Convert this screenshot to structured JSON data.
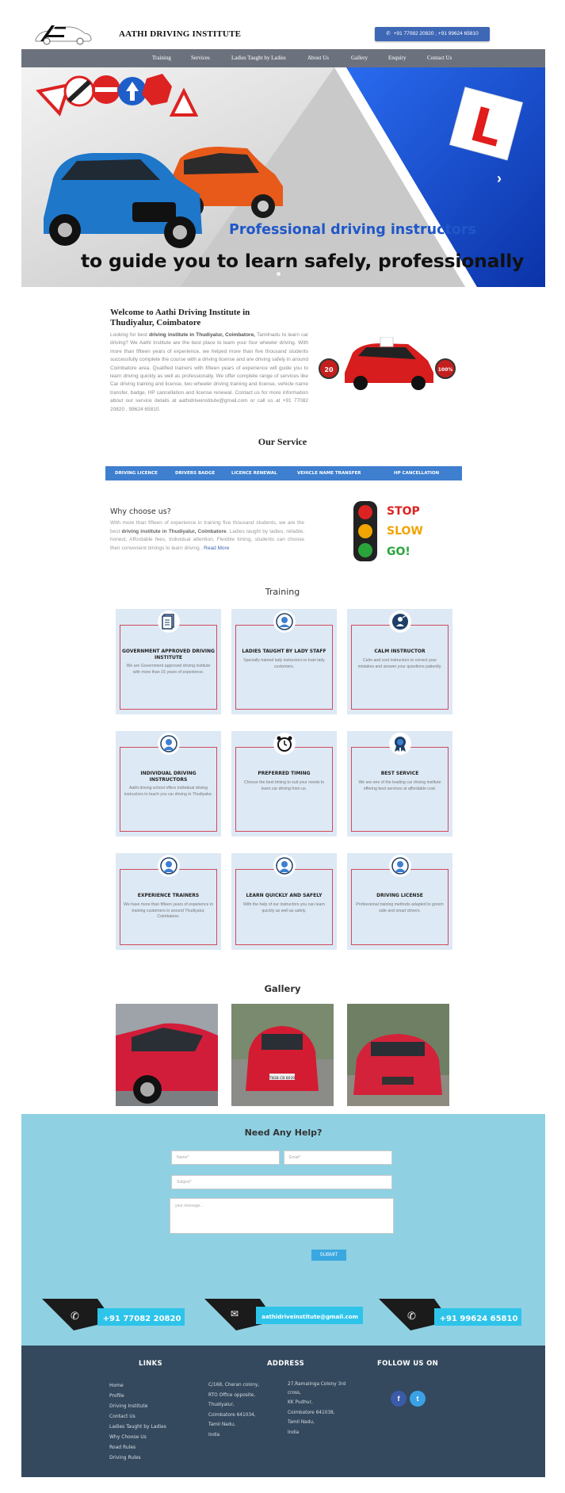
{
  "header": {
    "title": "AATHI DRIVING INSTITUTE",
    "phones": "+91 77082 20820 ,  +91 99624 65810"
  },
  "nav": [
    "Training",
    "Services",
    "Ladies Taught by Ladies",
    "About Us",
    "Gallery",
    "Enquiry",
    "Contact Us"
  ],
  "hero": {
    "headline": "Professional driving instructors",
    "subline": "to guide you to learn safely, professionally",
    "signs": [
      "GIVE WAY",
      "STOP"
    ],
    "plate": "L"
  },
  "welcome": {
    "title": "Welcome to Aathi Driving Institute in Thudiyalur, Coimbatore",
    "text_1": "Looking for best ",
    "bold_1": "driving institute in Thudiyalur, Coimbatore,",
    "text_2": " Tamilnadu to learn car driving? We Aathi Institute are the best place to learn your four wheeler driving. With more than fifteen years of experience, we helped more than five thousand students successfully complete the course with a driving license and are driving safely in around Coimbatore area. Qualified trainers with fifteen years of experience will guide you to learn driving quickly as well as professionally. We offer complete range of services like Car driving training and license, two wheeler driving training and license, vehicle name transfer, badge, HP cancellation and license renewal. Contact us for more information about our service details at aathidriveinstitute@gmail.com or call us at  +91 77082 20820 ,  99624 65810.",
    "badge_left": "20",
    "badge_right": "100%"
  },
  "services": {
    "title": "Our Service",
    "items": [
      "DRIVING LICENCE",
      "DRIVERS BADGE",
      "LICENCE RENEWAL",
      "VEHICLE NAME TRANSFER",
      "HP CANCELLATION"
    ]
  },
  "why": {
    "title": "Why choose us?",
    "text_1": "With more than fifteen of experience in training five thousand students, we are the best ",
    "bold_1": "driving institute in Thudiyalur, Coimbatore",
    "text_2": ". Ladies taught by ladies, reliable, honest, Affordable fees, Individual attention, Flexible timing, students can choose their convenient timings to learn driving . ",
    "read_more": "Read More",
    "signal_words": [
      "STOP",
      "SLOW",
      "GO!"
    ]
  },
  "training": {
    "title": "Training",
    "cards": [
      {
        "icon": "document-icon",
        "title": "GOVERNMENT APPROVED DRIVING INSTITUTE",
        "text": "We are Government approved driving institute with more than 15 years of experience."
      },
      {
        "icon": "lady-icon",
        "title": "LADIES TAUGHT BY LADY STAFF",
        "text": "Specially trained lady instructors to train lady customers."
      },
      {
        "icon": "instructor-icon",
        "title": "CALM INSTRUCTOR",
        "text": "Calm and cool instructors to correct your mistakes and answer your questions patiently."
      },
      {
        "icon": "user-icon",
        "title": "INDIVIDUAL DRIVING INSTRUCTORS",
        "text": "Aathi driving school offers individual driving instructors to teach you car driving in Thudiyalur."
      },
      {
        "icon": "alarm-clock-icon",
        "title": "PREFERRED TIMING",
        "text": "Choose the best timing to suit your needs to learn car driving from us."
      },
      {
        "icon": "award-icon",
        "title": "BEST SERVICE",
        "text": "We are one of the leading car driving institute offering best services at affordable cost."
      },
      {
        "icon": "user-icon",
        "title": "EXPERIENCE TRAINERS",
        "text": "We have more than fifteen years of experience in training customers in around Thudiyalur, Coimbatore."
      },
      {
        "icon": "user-icon",
        "title": "LEARN QUICKLY AND SAFELY",
        "text": "With the help of our instructors you can learn quickly as well as safely."
      },
      {
        "icon": "user-icon",
        "title": "DRIVING LICENSE",
        "text": "Professional training methods adapted to groom safe and smart drivers."
      }
    ]
  },
  "gallery": {
    "title": "Gallery",
    "plate": "TN38 CB 8030"
  },
  "help": {
    "title": "Need Any Help?",
    "name_placeholder": "Name*",
    "email_placeholder": "Email*",
    "subject_placeholder": "Subject*",
    "message_placeholder": "your message...",
    "submit": "SUBMIT",
    "contact_1": "+91  77082  20820",
    "contact_email": "aathidriveinstitute@gmail.com",
    "contact_2": "+91  99624  65810"
  },
  "footer": {
    "links_title": "LINKS",
    "links": [
      "Home",
      "Profile",
      "Driving Institute",
      "Contact Us",
      "Ladies Taught by Ladies",
      "Why Choose Us",
      "Road Rules",
      "Driving Rules"
    ],
    "address_title": "ADDRESS",
    "address_1": [
      "C/168, Cheran colony,",
      "RTO Office opposite,",
      "Thudiyalur,",
      "Coimbatore 641034,",
      "Tamil Nadu,",
      "India"
    ],
    "address_2": [
      "27,Ramalinga Colony 3rd cross,",
      "KK Pudhur,",
      "Coimbatore 641038,",
      "Tamil Nadu,",
      "India"
    ],
    "follow_title": "FOLLOW US ON",
    "facebook": "f",
    "twitter": "t"
  },
  "colors": {
    "nav": "#6c727d",
    "phone_button": "#3e67b5",
    "service_bar": "#3e7fcf",
    "help_bg": "#8fd0e3",
    "footer_bg": "#34495e",
    "card_border": "#d14a5a"
  }
}
